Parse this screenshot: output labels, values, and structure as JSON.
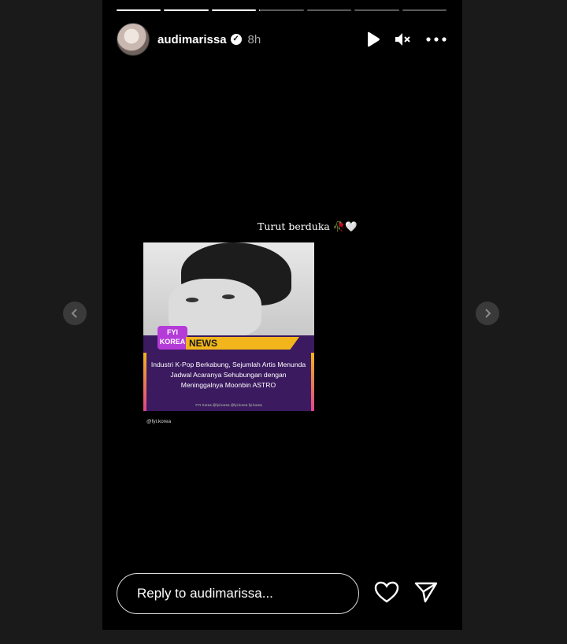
{
  "story": {
    "progress": [
      1,
      1,
      1,
      0.02,
      0,
      0,
      0
    ],
    "username": "audimarissa",
    "verified": "✓",
    "time": "8h"
  },
  "content": {
    "caption": "Turut berduka 🥀🤍",
    "badge": "FYI\nKOREA",
    "news_label": "NEWS",
    "headline": "Industri K-Pop Berkabung, Sejumlah Artis Menunda Jadwal Acaranya Sehubungan dengan Meninggalnya Moonbin ASTRO",
    "footer_strip": "FYI Korea  @fyi.korea  @fyi.korea  fyi.korea",
    "credit": "@fyi.korea"
  },
  "reply": {
    "placeholder": "Reply to audimarissa..."
  },
  "icons": {
    "play": "play-icon",
    "mute": "mute-icon",
    "more": "more-icon",
    "heart": "heart-icon",
    "send": "send-icon",
    "prev": "chevron-left-icon",
    "next": "chevron-right-icon"
  }
}
